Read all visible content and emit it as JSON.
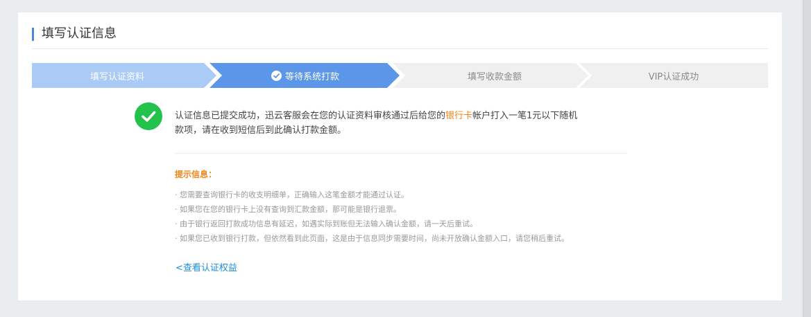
{
  "header": {
    "title": "填写认证信息"
  },
  "steps": [
    {
      "label": "填写认证资料",
      "state": "done"
    },
    {
      "label": "等待系统打款",
      "state": "current"
    },
    {
      "label": "填写收款金额",
      "state": "pending"
    },
    {
      "label": "VIP认证成功",
      "state": "pending"
    }
  ],
  "message": {
    "line1_before": "认证信息已提交成功，迅云客服会在您的认证资料审核通过后给您的",
    "highlight": "银行卡",
    "line1_after": "帐户打入一笔1元以下随机",
    "line2": "款项，请在收到短信后到此确认打款金额。"
  },
  "tips": {
    "title": "提示信息：",
    "items": [
      "· 您需要查询银行卡的收支明细单，正确输入这笔金额才能通过认证。",
      "· 如果您在您的银行卡上没有查询到汇款金额，那可能是银行退票。",
      "· 由于银行返回打款成功信息有延迟，如遇实际到账但无法输入确认金额，请一天后重试。",
      "· 如果您已收到银行打款，但依然看到此页面，这是由于信息同步需要时间，尚未开放确认金额入口，请您稍后重试。"
    ]
  },
  "link": {
    "label": "<查看认证权益"
  },
  "colors": {
    "accent": "#4a86e8",
    "step_done": "#a9cbf6",
    "step_current": "#5b96e8",
    "step_pending": "#f0f0f0",
    "success": "#23c24b",
    "highlight": "#f08519",
    "link": "#1a8ddb"
  }
}
